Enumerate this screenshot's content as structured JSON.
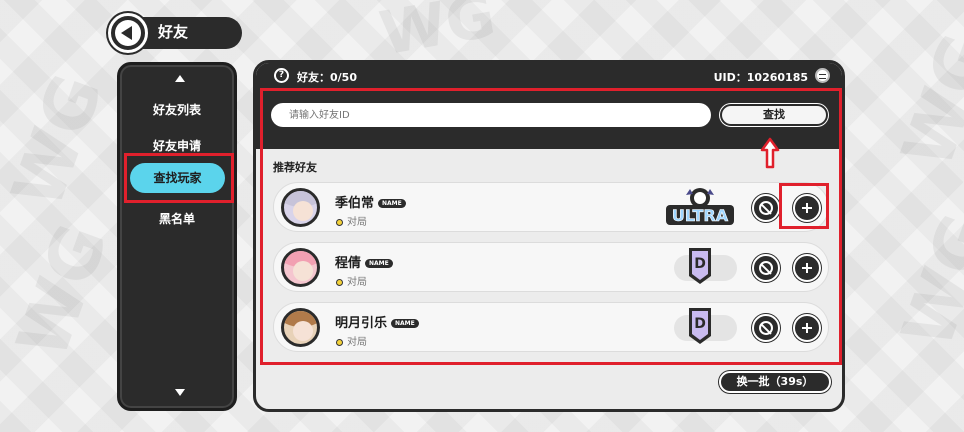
{
  "header": {
    "title": "好友"
  },
  "sidebar": {
    "items": [
      {
        "label": "好友列表"
      },
      {
        "label": "好友申请"
      },
      {
        "label": "查找玩家",
        "active": true
      },
      {
        "label": "黑名单"
      }
    ]
  },
  "panel": {
    "help_icon_glyph": "?",
    "friend_count": "好友：0/50",
    "uid": "UID：10260185",
    "search": {
      "placeholder": "请输入好友ID",
      "value": ""
    },
    "search_button": "查找",
    "section_title": "推荐好友",
    "players": [
      {
        "name": "季伯常",
        "tag": "NAME",
        "status": "对局",
        "badge": "ULTRA",
        "avatar": "silver-hair-girl"
      },
      {
        "name": "程倩",
        "tag": "NAME",
        "status": "对局",
        "badge": "D",
        "avatar": "pink-hair-girl"
      },
      {
        "name": "明月引乐",
        "tag": "NAME",
        "status": "对局",
        "badge": "D",
        "avatar": "brown-hair-girl"
      }
    ],
    "refresh_button": "换一批（39s）"
  },
  "icons": {
    "back": "back-arrow-icon",
    "help": "help-icon",
    "currency": "coin-icon",
    "block": "block-icon",
    "add": "add-friend-icon"
  },
  "colors": {
    "accent": "#5bd4ec",
    "dark": "#2b2b2b",
    "highlight": "#e0202c",
    "status_dot": "#f4d23a"
  }
}
